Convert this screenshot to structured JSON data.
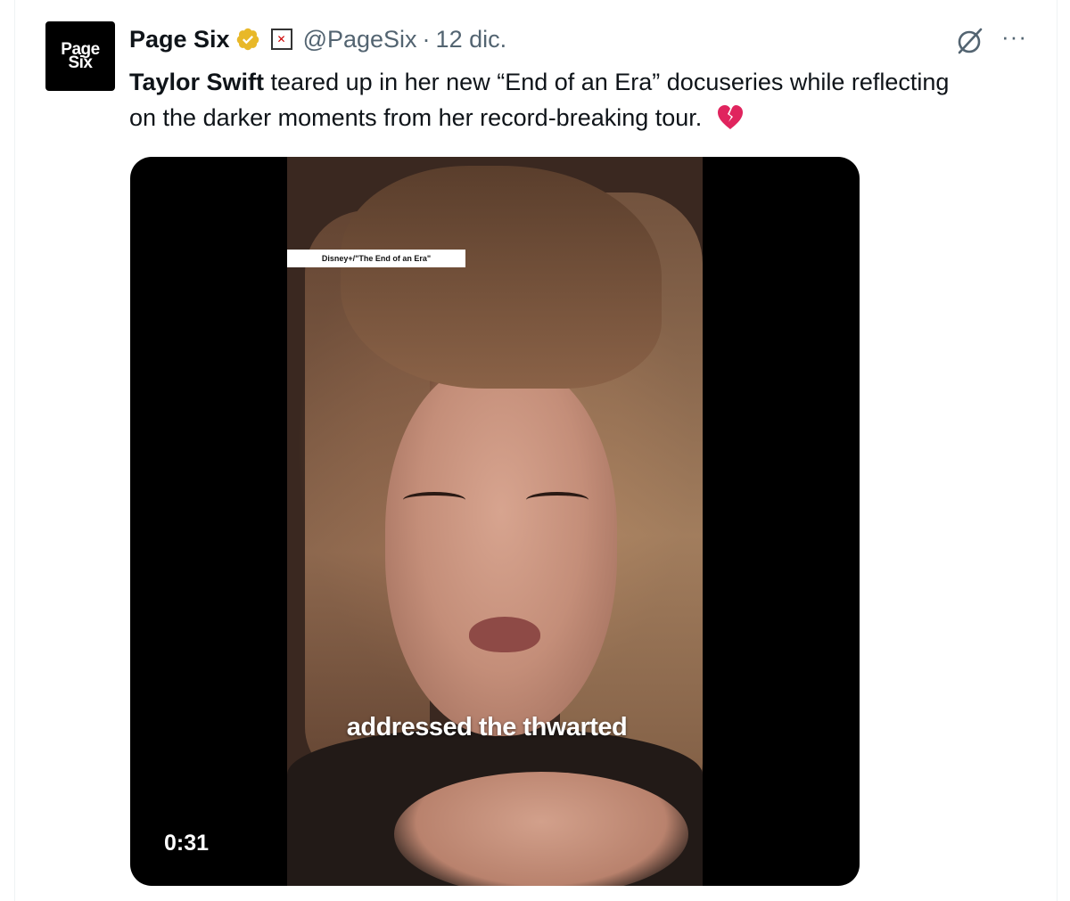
{
  "tweet": {
    "avatar_text": [
      "Page",
      "Six"
    ],
    "display_name": "Page Six",
    "handle": "@PageSix",
    "separator": "·",
    "date": "12 dic.",
    "text_bold": "Taylor Swift",
    "text_rest": " teared up in her new “End of an Era” docuseries while reflecting on the darker moments from her record-breaking tour.",
    "emoji": "broken-heart-emoji",
    "icons": {
      "verified": "verified-gold-badge-icon",
      "affiliate": "affiliate-badge-icon",
      "grok": "grok-icon",
      "more": "more-icon"
    },
    "more_label": "···",
    "colors": {
      "verified": "#e8b829",
      "heart": "#e0245e"
    }
  },
  "media": {
    "credit": "Disney+/\"The End of an Era\"",
    "caption": "addressed the thwarted",
    "duration": "0:31"
  }
}
